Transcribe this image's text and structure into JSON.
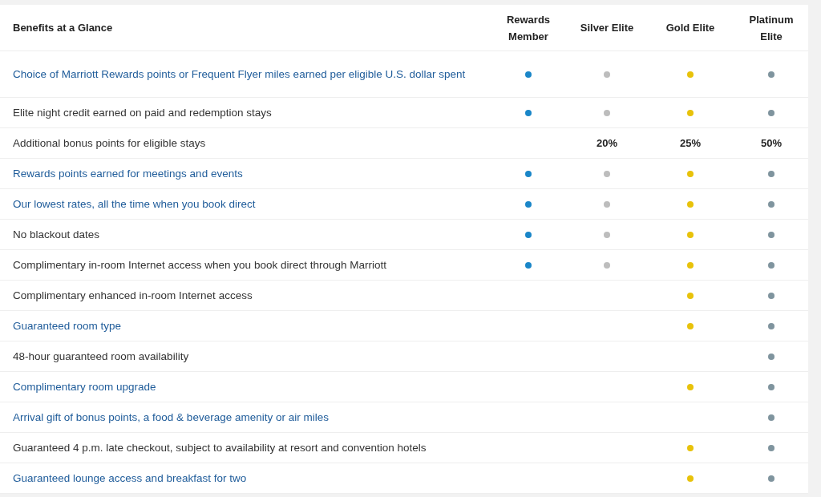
{
  "table": {
    "title": "Benefits at a Glance",
    "columns": [
      {
        "label": "Rewards Member",
        "color": "#1a86c8"
      },
      {
        "label": "Silver Elite",
        "color": "#bdbdbd"
      },
      {
        "label": "Gold Elite",
        "color": "#e8c20a"
      },
      {
        "label": "Platinum Elite",
        "color": "#7f949e"
      }
    ],
    "rows": [
      {
        "benefit": "Choice of Marriott Rewards points or Frequent Flyer miles earned per eligible U.S. dollar spent",
        "kind": "link",
        "cells": [
          {
            "kind": "dot"
          },
          {
            "kind": "dot"
          },
          {
            "kind": "dot"
          },
          {
            "kind": "dot"
          }
        ]
      },
      {
        "benefit": "Elite night credit earned on paid and redemption stays",
        "kind": "text",
        "cells": [
          {
            "kind": "dot"
          },
          {
            "kind": "dot"
          },
          {
            "kind": "dot"
          },
          {
            "kind": "dot"
          }
        ]
      },
      {
        "benefit": "Additional bonus points for eligible stays",
        "kind": "text",
        "cells": [
          {
            "kind": "none"
          },
          {
            "kind": "value",
            "text": "20%"
          },
          {
            "kind": "value",
            "text": "25%"
          },
          {
            "kind": "value",
            "text": "50%"
          }
        ]
      },
      {
        "benefit": "Rewards points earned for meetings and events",
        "kind": "link",
        "cells": [
          {
            "kind": "dot"
          },
          {
            "kind": "dot"
          },
          {
            "kind": "dot"
          },
          {
            "kind": "dot"
          }
        ]
      },
      {
        "benefit": "Our lowest rates, all the time when you book direct",
        "kind": "link",
        "cells": [
          {
            "kind": "dot"
          },
          {
            "kind": "dot"
          },
          {
            "kind": "dot"
          },
          {
            "kind": "dot"
          }
        ]
      },
      {
        "benefit": "No blackout dates",
        "kind": "text",
        "cells": [
          {
            "kind": "dot"
          },
          {
            "kind": "dot"
          },
          {
            "kind": "dot"
          },
          {
            "kind": "dot"
          }
        ]
      },
      {
        "benefit": "Complimentary in-room Internet access when you book direct through Marriott",
        "kind": "text",
        "cells": [
          {
            "kind": "dot"
          },
          {
            "kind": "dot"
          },
          {
            "kind": "dot"
          },
          {
            "kind": "dot"
          }
        ]
      },
      {
        "benefit": "Complimentary enhanced in-room Internet access",
        "kind": "text",
        "cells": [
          {
            "kind": "none"
          },
          {
            "kind": "none"
          },
          {
            "kind": "dot"
          },
          {
            "kind": "dot"
          }
        ]
      },
      {
        "benefit": "Guaranteed room type",
        "kind": "link",
        "cells": [
          {
            "kind": "none"
          },
          {
            "kind": "none"
          },
          {
            "kind": "dot"
          },
          {
            "kind": "dot"
          }
        ]
      },
      {
        "benefit": "48-hour guaranteed room availability",
        "kind": "text",
        "cells": [
          {
            "kind": "none"
          },
          {
            "kind": "none"
          },
          {
            "kind": "none"
          },
          {
            "kind": "dot"
          }
        ]
      },
      {
        "benefit": "Complimentary room upgrade",
        "kind": "link",
        "cells": [
          {
            "kind": "none"
          },
          {
            "kind": "none"
          },
          {
            "kind": "dot"
          },
          {
            "kind": "dot"
          }
        ]
      },
      {
        "benefit": "Arrival gift of bonus points, a food & beverage amenity or air miles",
        "kind": "link",
        "cells": [
          {
            "kind": "none"
          },
          {
            "kind": "none"
          },
          {
            "kind": "none"
          },
          {
            "kind": "dot"
          }
        ]
      },
      {
        "benefit": "Guaranteed 4 p.m. late checkout, subject to availability at resort and convention hotels",
        "kind": "text",
        "cells": [
          {
            "kind": "none"
          },
          {
            "kind": "none"
          },
          {
            "kind": "dot"
          },
          {
            "kind": "dot"
          }
        ]
      },
      {
        "benefit": "Guaranteed lounge access and breakfast for two",
        "kind": "link",
        "cells": [
          {
            "kind": "none"
          },
          {
            "kind": "none"
          },
          {
            "kind": "dot"
          },
          {
            "kind": "dot"
          }
        ]
      }
    ]
  }
}
